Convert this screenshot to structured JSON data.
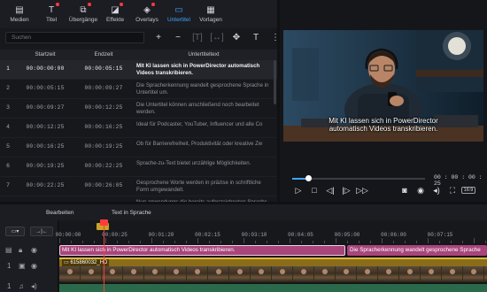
{
  "toolbar": {
    "items": [
      {
        "label": "Medien",
        "icon": "media-icon",
        "has_dot": false,
        "active": false
      },
      {
        "label": "Titel",
        "icon": "title-icon",
        "has_dot": true,
        "active": false
      },
      {
        "label": "Übergänge",
        "icon": "transitions-icon",
        "has_dot": true,
        "active": false
      },
      {
        "label": "Effekte",
        "icon": "effects-icon",
        "has_dot": true,
        "active": false
      },
      {
        "label": "Overlays",
        "icon": "overlays-icon",
        "has_dot": true,
        "active": false
      },
      {
        "label": "Untertitel",
        "icon": "subtitles-icon",
        "has_dot": false,
        "active": true
      },
      {
        "label": "Vorlagen",
        "icon": "templates-icon",
        "has_dot": false,
        "active": false
      }
    ]
  },
  "subtitle_panel": {
    "search_placeholder": "Suchen",
    "columns": {
      "start": "Startzeit",
      "end": "Endzeit",
      "text": "Untertiteltext"
    },
    "rows": [
      {
        "idx": "1",
        "start": "00:00:00:00",
        "end": "00:00:05:15",
        "text": "Mit KI lassen sich in PowerDirector automatisch Videos transkribieren.",
        "selected": true
      },
      {
        "idx": "2",
        "start": "00:00:05:15",
        "end": "00:00:09:27",
        "text": "Die Spracherkennung wandelt gesprochene Sprache in Untertitel um.",
        "selected": false
      },
      {
        "idx": "3",
        "start": "00:00:09:27",
        "end": "00:00:12:25",
        "text": "Die Untertitel können anschließend noch bearbeitet werden.",
        "selected": false
      },
      {
        "idx": "4",
        "start": "00:00:12:25",
        "end": "00:00:16:25",
        "text": "Ideal für Podcaster, YouTuber, Influencer und alle Co",
        "selected": false
      },
      {
        "idx": "5",
        "start": "00:00:16:25",
        "end": "00:00:19:25",
        "text": "Ob für Barrierefreiheit, Produktivität oder kreative Zw",
        "selected": false
      },
      {
        "idx": "6",
        "start": "00:00:19:25",
        "end": "00:00:22:25",
        "text": "Sprache-zu-Text bietet unzählige Möglichkeiten.",
        "selected": false
      },
      {
        "idx": "7",
        "start": "00:00:22:25",
        "end": "00:00:26:05",
        "text": "Gesprochene Worte werden in präzise in schriftliche Form umgewandelt.",
        "selected": false
      },
      {
        "idx": "8",
        "start": "",
        "end": "",
        "text": "Nun anwendungs die bereits aufgezeichneten Sprachs",
        "selected": false
      }
    ]
  },
  "preview": {
    "caption_line1": "Mit KI lassen sich in PowerDirector",
    "caption_line2": "automatisch Videos transkribieren.",
    "time": "00 : 00 : 00 : 25",
    "progress_fraction": 0.12,
    "ratio_label": "16:9"
  },
  "timeline": {
    "tabs": [
      "Bearbeiten",
      "Text in Sprache"
    ],
    "ruler": [
      "00:00:00",
      "00:00:25",
      "00:01:20",
      "00:02:15",
      "00:03:10",
      "00:04:05",
      "00:05:00",
      "00:06:00",
      "00:07:15"
    ],
    "subtitle_clip1": "Mit KI lassen sich in PowerDirector  automatisch Videos transkribieren.",
    "subtitle_clip2": "Die Spracherkennung wandelt gesprochene Sprache",
    "video_clip": "615860032_HD",
    "track_numbers": [
      "1",
      "1"
    ]
  },
  "colors": {
    "accent": "#3da5ff",
    "subtitle_clip": "#a8457b",
    "video_clip": "#8a6d1a",
    "playhead": "#ff3c3c"
  }
}
